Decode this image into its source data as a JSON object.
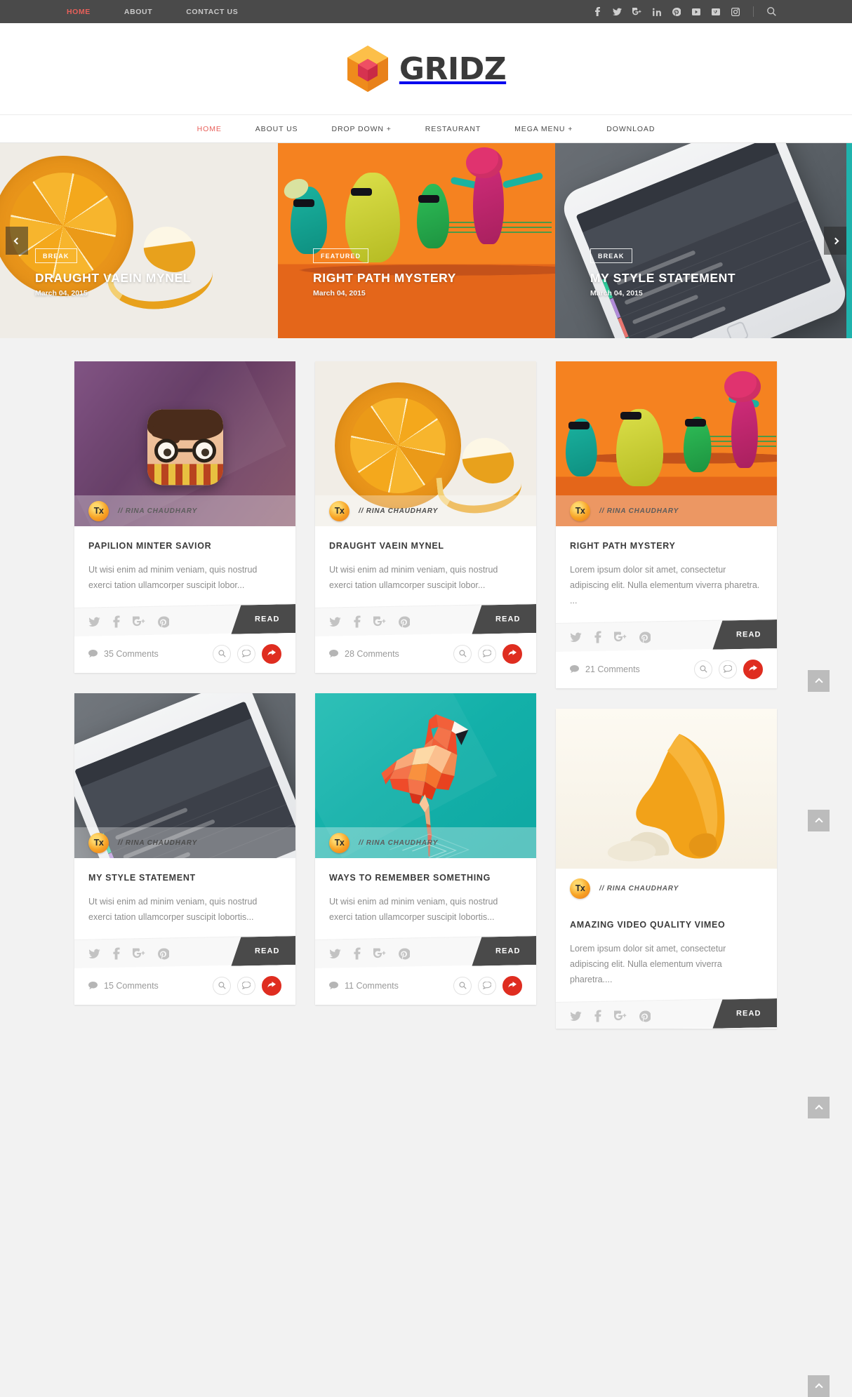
{
  "topbar": {
    "nav": [
      {
        "label": "HOME",
        "active": true
      },
      {
        "label": "ABOUT",
        "active": false
      },
      {
        "label": "CONTACT US",
        "active": false
      }
    ],
    "social": [
      {
        "name": "facebook-icon",
        "glyph": "f"
      },
      {
        "name": "twitter-icon",
        "glyph": "t"
      },
      {
        "name": "googleplus-icon",
        "glyph": "g+"
      },
      {
        "name": "linkedin-icon",
        "glyph": "in"
      },
      {
        "name": "pinterest-icon",
        "glyph": "p"
      },
      {
        "name": "youtube-icon",
        "glyph": "yt"
      },
      {
        "name": "vimeo-icon",
        "glyph": "v"
      },
      {
        "name": "instagram-icon",
        "glyph": "ig"
      }
    ],
    "search_icon": "search-icon"
  },
  "brand": {
    "name": "GRIDZ",
    "logo_icon": "hexagon-cube-logo",
    "logo_colors": {
      "hex_outer": "#f79a1f",
      "hex_light": "#fcbf49",
      "cube": "#e23a55"
    }
  },
  "mainnav": [
    {
      "label": "HOME",
      "active": true
    },
    {
      "label": "ABOUT US",
      "active": false
    },
    {
      "label": "DROP DOWN +",
      "active": false
    },
    {
      "label": "RESTAURANT",
      "active": false
    },
    {
      "label": "MEGA MENU +",
      "active": false
    },
    {
      "label": "DOWNLOAD",
      "active": false
    }
  ],
  "slider": {
    "prev_label": "previous-slide",
    "next_label": "next-slide",
    "slides": [
      {
        "badge": "BREAK",
        "title": "DRAUGHT VAEIN MYNEL",
        "date": "March 04, 2015",
        "art": "orange-slice-photo"
      },
      {
        "badge": "FEATURED",
        "title": "RIGHT PATH MYSTERY",
        "date": "March 04, 2015",
        "art": "clay-characters-photo"
      },
      {
        "badge": "BREAK",
        "title": "MY STYLE STATEMENT",
        "date": "March 04, 2015",
        "art": "iphone-todo-app-photo"
      }
    ]
  },
  "author": {
    "initials": "Tx",
    "name": "// RINA CHAUDHARY"
  },
  "labels": {
    "read": "READ",
    "comments_suffix": "Comments",
    "search_icon": "search-icon",
    "comment_icon": "comment-icon",
    "share_icon": "share-icon",
    "scroll_top": "scroll-to-top"
  },
  "card_social": [
    {
      "name": "twitter-icon"
    },
    {
      "name": "facebook-icon"
    },
    {
      "name": "googleplus-icon"
    },
    {
      "name": "pinterest-icon"
    }
  ],
  "posts": [
    {
      "title": "PAPILION MINTER SAVIOR",
      "excerpt": "Ut wisi enim ad minim veniam, quis nostrud exerci tation ullamcorper suscipit lobor...",
      "comments": "35 Comments",
      "art": "harry-potter-app-icon",
      "author_overlay": true
    },
    {
      "title": "DRAUGHT VAEIN MYNEL",
      "excerpt": "Ut wisi enim ad minim veniam, quis nostrud exerci tation ullamcorper suscipit lobor...",
      "comments": "28 Comments",
      "art": "orange-slice-photo",
      "author_overlay": true
    },
    {
      "title": "RIGHT PATH MYSTERY",
      "excerpt": "Lorem ipsum dolor sit amet, consectetur adipiscing elit. Nulla elementum viverra pharetra. ...",
      "comments": "21 Comments",
      "art": "clay-characters-photo",
      "author_overlay": true
    },
    {
      "title": "MY STYLE STATEMENT",
      "excerpt": "Ut wisi enim ad minim veniam, quis nostrud exerci tation ullamcorper suscipit lobortis...",
      "comments": "15 Comments",
      "art": "iphone-todo-app-photo",
      "author_overlay": true
    },
    {
      "title": "WAYS TO REMEMBER SOMETHING",
      "excerpt": "Ut wisi enim ad minim veniam, quis nostrud exerci tation ullamcorper suscipit lobortis...",
      "comments": "11 Comments",
      "art": "lowpoly-flamingo-photo",
      "author_overlay": true
    },
    {
      "title": "AMAZING VIDEO QUALITY VIMEO",
      "excerpt": "Lorem ipsum dolor sit amet, consectetur adipiscing elit. Nulla elementum viverra pharetra....",
      "comments": "",
      "art": "orange-cloth-photo",
      "author_overlay": false
    }
  ],
  "colors": {
    "accent_red": "#e8605a",
    "share_red": "#df2d20",
    "dark": "#4a4a4a",
    "page_bg": "#f2f2f2"
  }
}
